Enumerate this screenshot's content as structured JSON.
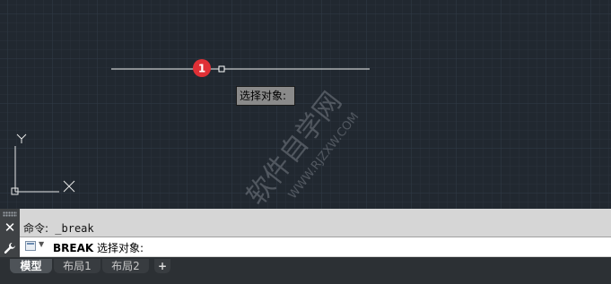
{
  "canvas": {
    "background": "#212830",
    "marker_number": "1",
    "marker_color": "#e03036",
    "watermark_text": "软件自学网",
    "watermark_url": "WWW.RJZXW.COM"
  },
  "tooltip": {
    "text": "选择对象:"
  },
  "command": {
    "history_prefix": "命令:",
    "history_command": " _break",
    "input_keyword": "BREAK",
    "input_prompt": " 选择对象:",
    "close_icon": "close-icon",
    "settings_icon": "wrench-icon"
  },
  "tabs": {
    "model": "模型",
    "layout1": "布局1",
    "layout2": "布局2",
    "add": "+"
  },
  "colors": {
    "grid_minor": "#2a323c",
    "grid_major": "#303a46",
    "panel": "#d6d6d6",
    "tab_bar": "#2c3034"
  }
}
